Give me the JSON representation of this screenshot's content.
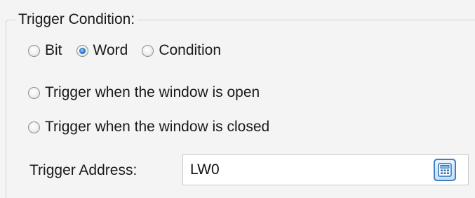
{
  "trigger_condition": {
    "legend": "Trigger Condition:",
    "mode_options": [
      {
        "label": "Bit",
        "checked": false
      },
      {
        "label": "Word",
        "checked": true
      },
      {
        "label": "Condition",
        "checked": false
      }
    ],
    "window_options": [
      {
        "label": "Trigger when the window is open",
        "checked": false
      },
      {
        "label": "Trigger when the window is closed",
        "checked": false
      }
    ],
    "address": {
      "label": "Trigger Address:",
      "value": "LW0",
      "button_icon": "calculator-icon"
    }
  },
  "colors": {
    "accent": "#3b8ed8",
    "background": "#f4f4f4",
    "field_background": "#ffffff"
  }
}
